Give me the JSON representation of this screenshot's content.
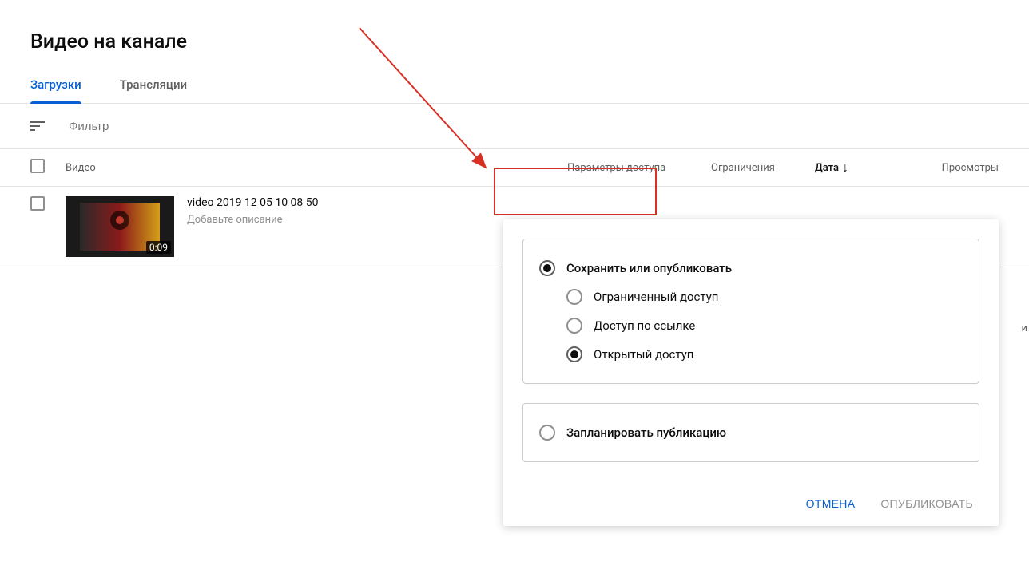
{
  "page": {
    "title": "Видео на канале"
  },
  "tabs": {
    "uploads": "Загрузки",
    "live": "Трансляции"
  },
  "filter": {
    "placeholder": "Фильтр"
  },
  "columns": {
    "video": "Видео",
    "access": "Параметры доступа",
    "restrictions": "Ограничения",
    "date": "Дата",
    "views": "Просмотры"
  },
  "video": {
    "title": "video 2019 12 05 10 08 50",
    "description": "Добавьте описание",
    "duration": "0:09"
  },
  "popover": {
    "save_or_publish": "Сохранить или опубликовать",
    "private": "Ограниченный доступ",
    "unlisted": "Доступ по ссылке",
    "public": "Открытый доступ",
    "schedule": "Запланировать публикацию",
    "cancel": "ОТМЕНА",
    "publish": "ОПУБЛИКОВАТЬ"
  },
  "truncated": "и"
}
